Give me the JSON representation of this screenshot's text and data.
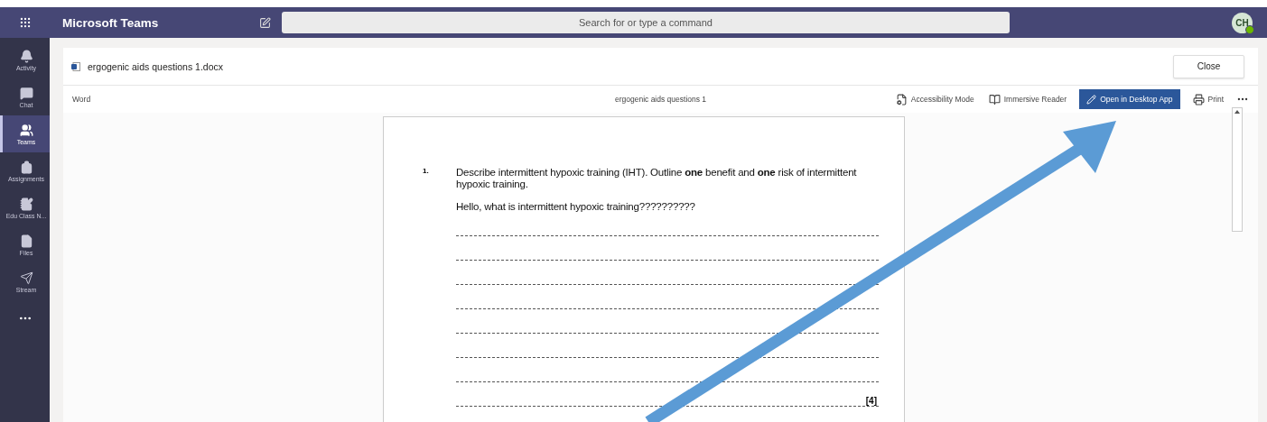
{
  "app": {
    "title": "Microsoft Teams",
    "search": {
      "placeholder": "Search for or type a command"
    },
    "avatar": {
      "initials": "CH",
      "online": true
    }
  },
  "rail": [
    {
      "kind": "activity",
      "label": "Activity",
      "selected": false
    },
    {
      "kind": "chat",
      "label": "Chat",
      "selected": false
    },
    {
      "kind": "teams",
      "label": "Teams",
      "selected": true
    },
    {
      "kind": "assignments",
      "label": "Assignments",
      "selected": false
    },
    {
      "kind": "notebook",
      "label": "Edu Class N...",
      "selected": false
    },
    {
      "kind": "files",
      "label": "Files",
      "selected": false
    },
    {
      "kind": "stream",
      "label": "Stream",
      "selected": false
    }
  ],
  "file": {
    "name": "ergogenic aids questions 1.docx",
    "close": "Close"
  },
  "toolbar": {
    "app": "Word",
    "title": "ergogenic aids questions 1",
    "actions": [
      {
        "kind": "accessibility",
        "label": "Accessibility Mode",
        "primary": false
      },
      {
        "kind": "reader",
        "label": "Immersive Reader",
        "primary": false
      },
      {
        "kind": "desktop",
        "label": "Open in Desktop App",
        "primary": true
      },
      {
        "kind": "print",
        "label": "Print",
        "primary": false
      }
    ]
  },
  "question": {
    "number": "1.",
    "prompt": "Describe intermittent hypoxic training (IHT). Outline **one** benefit and **one** risk of intermittent hypoxic training.",
    "answer": "Hello, what is intermittent hypoxic training??????????",
    "marks": "[4]"
  }
}
